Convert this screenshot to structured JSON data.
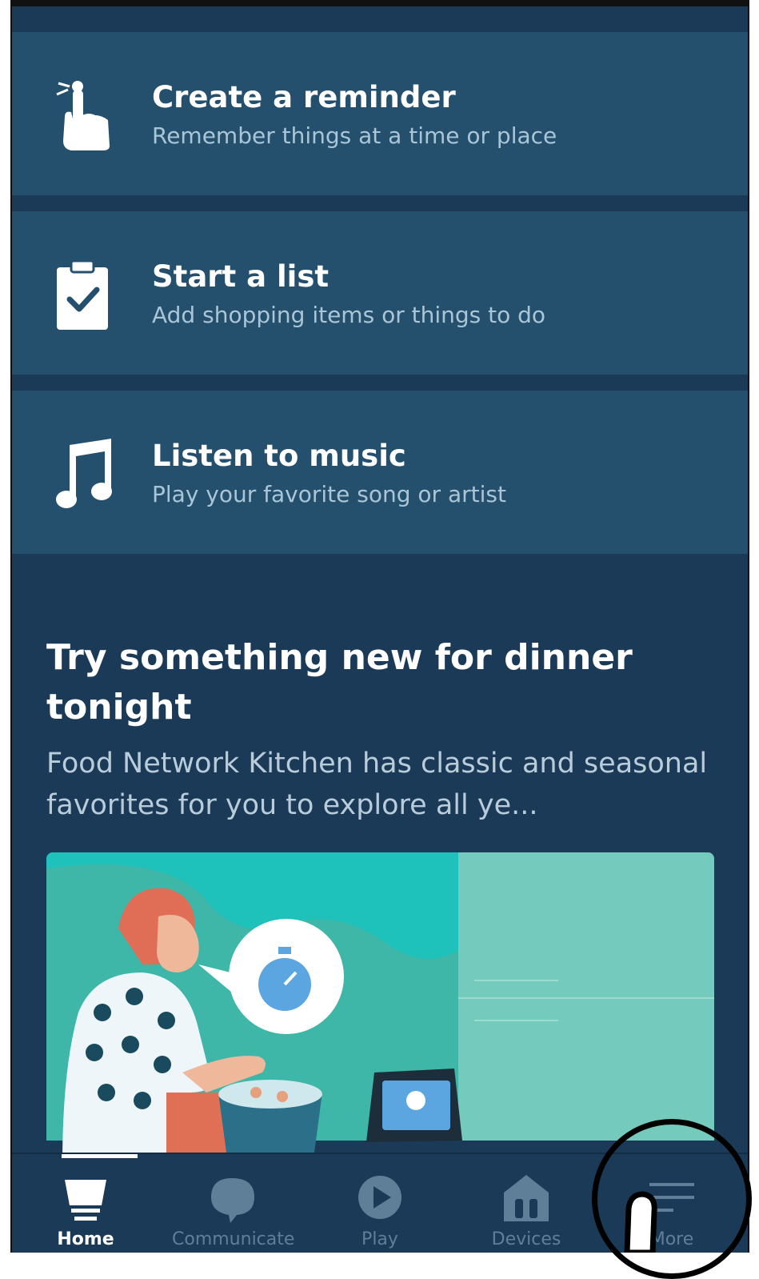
{
  "cards": [
    {
      "icon": "hand-tap-icon",
      "title": "Create a reminder",
      "subtitle": "Remember things at a time or place"
    },
    {
      "icon": "clipboard-check-icon",
      "title": "Start a list",
      "subtitle": "Add shopping items or things to do"
    },
    {
      "icon": "music-note-icon",
      "title": "Listen to music",
      "subtitle": "Play your favorite song or artist"
    }
  ],
  "promo": {
    "title": "Try something new for dinner tonight",
    "description": "Food Network Kitchen has classic and seasonal favorites for you to explore all ye..."
  },
  "nav": {
    "items": [
      {
        "label": "Home",
        "icon": "home-icon",
        "active": true
      },
      {
        "label": "Communicate",
        "icon": "chat-bubble-icon",
        "active": false
      },
      {
        "label": "Play",
        "icon": "play-icon",
        "active": false
      },
      {
        "label": "Devices",
        "icon": "devices-icon",
        "active": false
      },
      {
        "label": "More",
        "icon": "menu-icon",
        "active": false
      }
    ]
  },
  "colors": {
    "background": "#1b3a57",
    "card": "#24506e",
    "text": "#ffffff",
    "subtext": "#aac6d6",
    "nav_inactive": "#5f7f98"
  }
}
